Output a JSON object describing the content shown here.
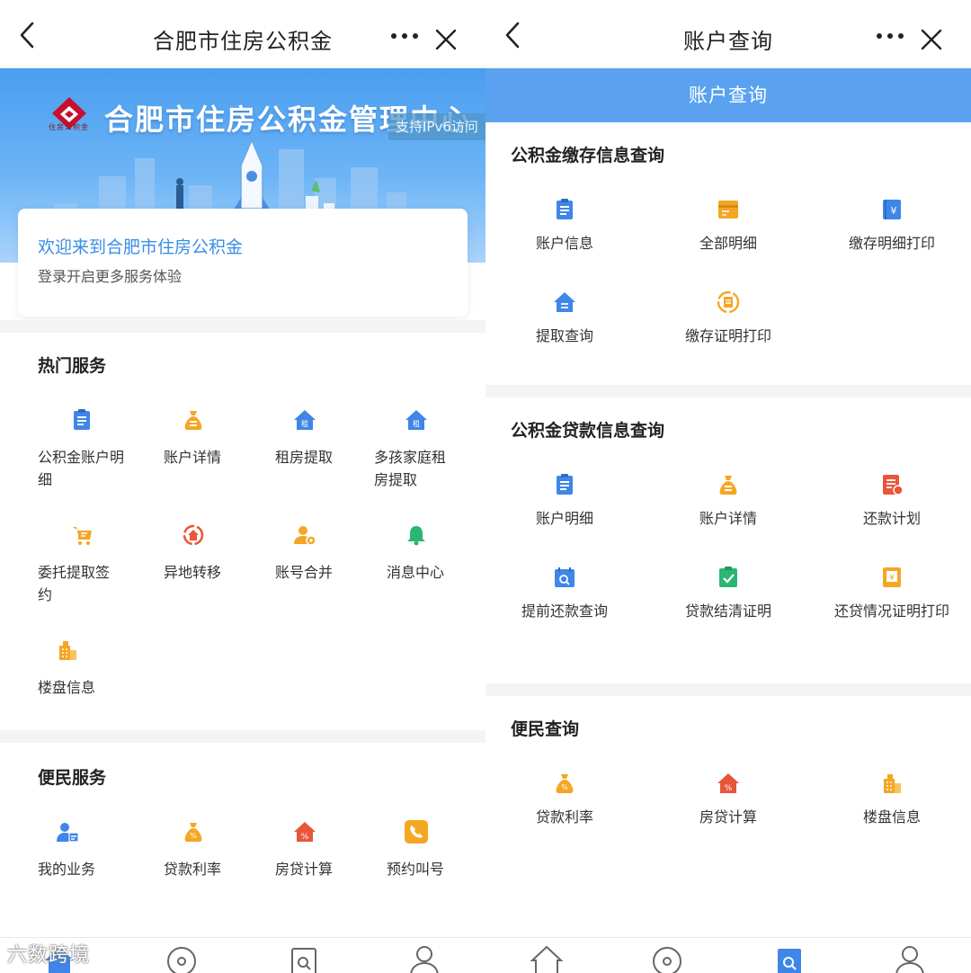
{
  "left": {
    "title": "合肥市住房公积金",
    "banner": {
      "title": "合肥市住房公积金管理中心",
      "logo_caption": "住房公积金",
      "ipv6": "支持IPv6访问"
    },
    "welcome": {
      "headline": "欢迎来到合肥市住房公积金",
      "sub": "登录开启更多服务体验"
    },
    "hot": {
      "title": "热门服务",
      "items": [
        {
          "label": "公积金账户明细",
          "icon": "clipboard-icon"
        },
        {
          "label": "账户详情",
          "icon": "money-bag-icon"
        },
        {
          "label": "租房提取",
          "icon": "rent-house-icon"
        },
        {
          "label": "多孩家庭租房提取",
          "icon": "rent-house-icon"
        },
        {
          "label": "委托提取签约",
          "icon": "sign-cart-icon"
        },
        {
          "label": "异地转移",
          "icon": "transfer-icon"
        },
        {
          "label": "账号合并",
          "icon": "user-merge-icon"
        },
        {
          "label": "消息中心",
          "icon": "bell-icon"
        },
        {
          "label": "楼盘信息",
          "icon": "building-icon"
        }
      ]
    },
    "civic": {
      "title": "便民服务",
      "items": [
        {
          "label": "我的业务",
          "icon": "user-id-icon"
        },
        {
          "label": "贷款利率",
          "icon": "money-bag-icon"
        },
        {
          "label": "房贷计算",
          "icon": "house-percent-icon"
        },
        {
          "label": "预约叫号",
          "icon": "phone-icon"
        }
      ]
    },
    "watermark": "六数跨境"
  },
  "right": {
    "title": "账户查询",
    "header": "账户查询",
    "deposit": {
      "title": "公积金缴存信息查询",
      "items": [
        {
          "label": "账户信息",
          "icon": "clipboard-icon"
        },
        {
          "label": "全部明细",
          "icon": "card-icon"
        },
        {
          "label": "缴存明细打印",
          "icon": "yuan-book-icon"
        },
        {
          "label": "提取查询",
          "icon": "house-doc-icon"
        },
        {
          "label": "缴存证明打印",
          "icon": "cert-cycle-icon"
        }
      ]
    },
    "loan": {
      "title": "公积金贷款信息查询",
      "items": [
        {
          "label": "账户明细",
          "icon": "clipboard-icon"
        },
        {
          "label": "账户详情",
          "icon": "money-bag-icon"
        },
        {
          "label": "还款计划",
          "icon": "plan-icon"
        },
        {
          "label": "提前还款查询",
          "icon": "calendar-search-icon"
        },
        {
          "label": "贷款结清证明",
          "icon": "check-board-icon"
        },
        {
          "label": "还贷情况证明打印",
          "icon": "receipt-icon"
        }
      ]
    },
    "civic": {
      "title": "便民查询",
      "items": [
        {
          "label": "贷款利率",
          "icon": "money-bag-icon"
        },
        {
          "label": "房贷计算",
          "icon": "house-percent-icon"
        },
        {
          "label": "楼盘信息",
          "icon": "building-icon"
        }
      ]
    }
  },
  "colors": {
    "accent": "#3a8ee6",
    "orange": "#f5a623",
    "red": "#e8563a",
    "green": "#2bb673",
    "blue": "#3f86e8"
  }
}
